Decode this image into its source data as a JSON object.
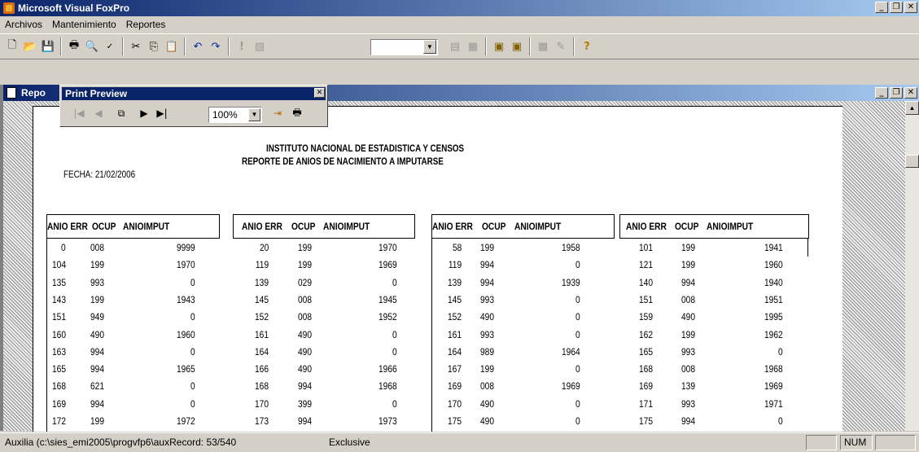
{
  "app": {
    "title": "Microsoft Visual FoxPro"
  },
  "menu": [
    "Archivos",
    "Mantenimiento",
    "Reportes"
  ],
  "child_window": {
    "title": "Repo"
  },
  "print_preview": {
    "title": "Print Preview",
    "zoom": "100%"
  },
  "report": {
    "header1": "INSTITUTO NACIONAL DE ESTADISTICA Y CENSOS",
    "header2": "REPORTE DE ANIOS DE NACIMIENTO A IMPUTARSE",
    "fecha": "FECHA:   21/02/2006",
    "columns": [
      "ANIO ERR",
      "OCUP",
      "ANIOIMPUT"
    ],
    "groups": [
      {
        "rows": [
          [
            "0",
            "008",
            "9999"
          ],
          [
            "104",
            "199",
            "1970"
          ],
          [
            "135",
            "993",
            "0"
          ],
          [
            "143",
            "199",
            "1943"
          ],
          [
            "151",
            "949",
            "0"
          ],
          [
            "160",
            "490",
            "1960"
          ],
          [
            "163",
            "994",
            "0"
          ],
          [
            "165",
            "994",
            "1965"
          ],
          [
            "168",
            "621",
            "0"
          ],
          [
            "169",
            "994",
            "0"
          ],
          [
            "172",
            "199",
            "1972"
          ]
        ]
      },
      {
        "rows": [
          [
            "20",
            "199",
            "1970"
          ],
          [
            "119",
            "199",
            "1969"
          ],
          [
            "139",
            "029",
            "0"
          ],
          [
            "145",
            "008",
            "1945"
          ],
          [
            "152",
            "008",
            "1952"
          ],
          [
            "161",
            "490",
            "0"
          ],
          [
            "164",
            "490",
            "0"
          ],
          [
            "166",
            "490",
            "1966"
          ],
          [
            "168",
            "994",
            "1968"
          ],
          [
            "170",
            "399",
            "0"
          ],
          [
            "173",
            "994",
            "1973"
          ]
        ]
      },
      {
        "rows": [
          [
            "58",
            "199",
            "1958"
          ],
          [
            "119",
            "994",
            "0"
          ],
          [
            "139",
            "994",
            "1939"
          ],
          [
            "145",
            "993",
            "0"
          ],
          [
            "152",
            "490",
            "0"
          ],
          [
            "161",
            "993",
            "0"
          ],
          [
            "164",
            "989",
            "1964"
          ],
          [
            "167",
            "199",
            "0"
          ],
          [
            "169",
            "008",
            "1969"
          ],
          [
            "170",
            "490",
            "0"
          ],
          [
            "175",
            "490",
            "0"
          ]
        ]
      },
      {
        "rows": [
          [
            "101",
            "199",
            "1941"
          ],
          [
            "121",
            "199",
            "1960"
          ],
          [
            "140",
            "994",
            "1940"
          ],
          [
            "151",
            "008",
            "1951"
          ],
          [
            "159",
            "490",
            "1995"
          ],
          [
            "162",
            "199",
            "1962"
          ],
          [
            "165",
            "993",
            "0"
          ],
          [
            "168",
            "008",
            "1968"
          ],
          [
            "169",
            "139",
            "1969"
          ],
          [
            "171",
            "993",
            "1971"
          ],
          [
            "175",
            "994",
            "0"
          ]
        ]
      }
    ]
  },
  "status": {
    "text": "Auxilia (c:\\sies_emi2005\\progvfp6\\auxRecord: 53/540",
    "mode": "Exclusive",
    "num": "NUM"
  },
  "icons": {
    "toolbar": [
      "new-icon",
      "open-icon",
      "save-icon",
      "print-icon",
      "print-preview-icon",
      "spell-check-icon",
      "cut-icon",
      "copy-icon",
      "paste-icon",
      "undo-icon",
      "redo-icon",
      "run-icon",
      "modify-form-icon",
      "form-wizard-icon",
      "report-wizard-icon",
      "database-icon",
      "data-session-icon",
      "command-window-icon",
      "properties-icon",
      "help-icon"
    ]
  }
}
